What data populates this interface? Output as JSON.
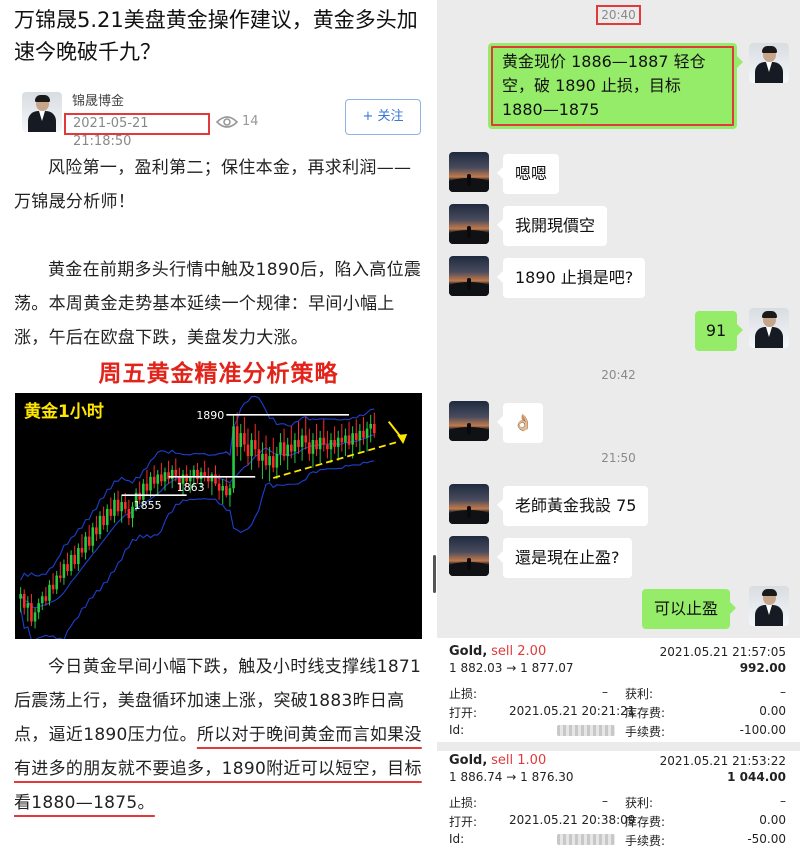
{
  "article": {
    "title": "万锦晟5.21美盘黄金操作建议，黄金多头加速今晚破千九？",
    "author": "锦晟博金",
    "time": "2021-05-21 21:18:50",
    "views": "14",
    "follow_label": "+ 关注",
    "para1": "风险第一，盈利第二；保住本金，再求利润——万锦晟分析师！",
    "para2": "黄金在前期多头行情中触及1890后，陷入高位震荡。本周黄金走势基本延续一个规律：早间小幅上涨，午后在欧盘下跌，美盘发力大涨。",
    "heading": "周五黄金精准分析策略",
    "para3_plain": "今日黄金早间小幅下跌，触及小时线支撑线1871后震荡上行，美盘循环加速上涨，突破1883昨日高点，逼近1890压力位。",
    "para3_underlined": "所以对于晚间黄金而言如果没有进多的朋友就不要追多，1890附近可以短空，目标看1880—1875。"
  },
  "chart_data": {
    "type": "candlestick",
    "title": "黄金1小时",
    "colors": {
      "up": "#27c93f",
      "down": "#ff2a2a",
      "band": "#1e3fd0",
      "level": "#ffffff",
      "trend": "#ffe600",
      "arrow": "#ffe600"
    },
    "levels": [
      {
        "label": "1890",
        "value": 1890
      },
      {
        "label": "1863",
        "value": 1863
      },
      {
        "label": "1855",
        "value": 1855
      }
    ],
    "x_range": [
      0,
      110
    ],
    "y_range": [
      1795,
      1896
    ],
    "trendline": {
      "from": [
        71,
        1862.5
      ],
      "to": [
        105,
        1878
      ]
    },
    "arrow": {
      "from": [
        103,
        1887
      ],
      "to": [
        107,
        1879
      ]
    },
    "candles": [
      [
        1810,
        1815,
        1804,
        1812
      ],
      [
        1812,
        1814,
        1803,
        1806
      ],
      [
        1806,
        1811,
        1800,
        1808
      ],
      [
        1808,
        1812,
        1798,
        1800
      ],
      [
        1800,
        1806,
        1797,
        1804
      ],
      [
        1804,
        1810,
        1801,
        1808
      ],
      [
        1808,
        1813,
        1805,
        1811
      ],
      [
        1811,
        1815,
        1807,
        1809
      ],
      [
        1809,
        1818,
        1807,
        1816
      ],
      [
        1816,
        1821,
        1812,
        1814
      ],
      [
        1814,
        1822,
        1812,
        1820
      ],
      [
        1820,
        1826,
        1817,
        1819
      ],
      [
        1819,
        1827,
        1816,
        1825
      ],
      [
        1825,
        1830,
        1820,
        1822
      ],
      [
        1822,
        1831,
        1820,
        1829
      ],
      [
        1829,
        1833,
        1823,
        1825
      ],
      [
        1825,
        1834,
        1822,
        1832
      ],
      [
        1832,
        1838,
        1828,
        1830
      ],
      [
        1830,
        1839,
        1827,
        1837
      ],
      [
        1837,
        1842,
        1831,
        1833
      ],
      [
        1833,
        1843,
        1830,
        1841
      ],
      [
        1841,
        1846,
        1835,
        1838
      ],
      [
        1838,
        1848,
        1836,
        1846
      ],
      [
        1846,
        1850,
        1840,
        1842
      ],
      [
        1842,
        1851,
        1839,
        1849
      ],
      [
        1849,
        1854,
        1844,
        1846
      ],
      [
        1846,
        1856,
        1843,
        1853
      ],
      [
        1853,
        1857,
        1846,
        1848
      ],
      [
        1848,
        1855,
        1843,
        1852
      ],
      [
        1852,
        1856,
        1847,
        1849
      ],
      [
        1849,
        1853,
        1842,
        1845
      ],
      [
        1845,
        1852,
        1841,
        1850
      ],
      [
        1850,
        1858,
        1848,
        1856
      ],
      [
        1856,
        1861,
        1851,
        1853
      ],
      [
        1853,
        1862,
        1850,
        1860
      ],
      [
        1860,
        1866,
        1855,
        1857
      ],
      [
        1857,
        1865,
        1854,
        1863
      ],
      [
        1863,
        1868,
        1858,
        1860
      ],
      [
        1860,
        1866,
        1855,
        1864
      ],
      [
        1864,
        1869,
        1859,
        1861
      ],
      [
        1861,
        1867,
        1857,
        1865
      ],
      [
        1865,
        1870,
        1860,
        1862
      ],
      [
        1862,
        1868,
        1858,
        1866
      ],
      [
        1866,
        1871,
        1861,
        1863
      ],
      [
        1863,
        1867,
        1857,
        1860
      ],
      [
        1860,
        1866,
        1855,
        1864
      ],
      [
        1864,
        1868,
        1859,
        1861
      ],
      [
        1861,
        1866,
        1856,
        1863
      ],
      [
        1863,
        1868,
        1859,
        1866
      ],
      [
        1866,
        1869,
        1860,
        1862
      ],
      [
        1862,
        1867,
        1858,
        1865
      ],
      [
        1865,
        1870,
        1861,
        1863
      ],
      [
        1863,
        1867,
        1858,
        1861
      ],
      [
        1861,
        1865,
        1855,
        1864
      ],
      [
        1864,
        1868,
        1859,
        1860
      ],
      [
        1860,
        1864,
        1853,
        1857
      ],
      [
        1857,
        1862,
        1851,
        1859
      ],
      [
        1859,
        1863,
        1854,
        1855
      ],
      [
        1855,
        1860,
        1850,
        1858
      ],
      [
        1858,
        1890,
        1856,
        1885
      ],
      [
        1885,
        1891,
        1872,
        1876
      ],
      [
        1876,
        1886,
        1870,
        1882
      ],
      [
        1882,
        1889,
        1874,
        1877
      ],
      [
        1877,
        1884,
        1868,
        1872
      ],
      [
        1872,
        1882,
        1866,
        1879
      ],
      [
        1879,
        1886,
        1872,
        1875
      ],
      [
        1875,
        1883,
        1867,
        1870
      ],
      [
        1870,
        1878,
        1862,
        1873
      ],
      [
        1873,
        1881,
        1866,
        1868
      ],
      [
        1868,
        1876,
        1861,
        1872
      ],
      [
        1872,
        1880,
        1865,
        1867
      ],
      [
        1867,
        1876,
        1862,
        1873
      ],
      [
        1873,
        1882,
        1868,
        1878
      ],
      [
        1878,
        1884,
        1870,
        1872
      ],
      [
        1872,
        1880,
        1866,
        1877
      ],
      [
        1877,
        1885,
        1871,
        1874
      ],
      [
        1874,
        1882,
        1869,
        1879
      ],
      [
        1879,
        1887,
        1873,
        1876
      ],
      [
        1876,
        1884,
        1870,
        1881
      ],
      [
        1881,
        1889,
        1875,
        1878
      ],
      [
        1878,
        1884,
        1870,
        1873
      ],
      [
        1873,
        1882,
        1867,
        1879
      ],
      [
        1879,
        1886,
        1872,
        1875
      ],
      [
        1875,
        1883,
        1869,
        1880
      ],
      [
        1880,
        1888,
        1874,
        1877
      ],
      [
        1877,
        1883,
        1871,
        1875
      ],
      [
        1875,
        1882,
        1869,
        1879
      ],
      [
        1879,
        1885,
        1873,
        1876
      ],
      [
        1876,
        1883,
        1870,
        1880
      ],
      [
        1880,
        1886,
        1874,
        1878
      ],
      [
        1878,
        1884,
        1872,
        1881
      ],
      [
        1881,
        1887,
        1875,
        1877
      ],
      [
        1877,
        1885,
        1871,
        1882
      ],
      [
        1882,
        1888,
        1876,
        1879
      ],
      [
        1879,
        1886,
        1873,
        1883
      ],
      [
        1883,
        1889,
        1877,
        1880
      ],
      [
        1880,
        1887,
        1874,
        1884
      ],
      [
        1884,
        1890,
        1878,
        1886
      ],
      [
        1886,
        1891,
        1880,
        1882
      ]
    ]
  },
  "chat": {
    "ts1": "20:40",
    "msg_out_1": "黄金现价 1886—1887 轻仓空，破 1890 止损，目标 1880—1875",
    "msg_in_1": "嗯嗯",
    "msg_in_2": "我開現價空",
    "msg_in_3": "1890 止損是吧?",
    "msg_out_2": "91",
    "ts2": "20:42",
    "msg_in_4": "👌🏼",
    "ts3": "21:50",
    "msg_in_5": "老師黃金我設 75",
    "msg_in_6": "還是現在止盈?",
    "msg_out_3": "可以止盈"
  },
  "trades": [
    {
      "symbol": "Gold,",
      "side": "sell 2.00",
      "close_time": "2021.05.21 21:57:05",
      "prices": "1 882.03 → 1 877.07",
      "profit": "992.00",
      "sl_label": "止损:",
      "sl_value": "–",
      "tp_label": "获利:",
      "tp_value": "–",
      "open_label": "打开:",
      "open_time": "2021.05.21 20:21:21",
      "swap_label": "库存费:",
      "swap_value": "0.00",
      "id_label": "Id:",
      "fee_label": "手续费:",
      "fee_value": "-100.00"
    },
    {
      "symbol": "Gold,",
      "side": "sell 1.00",
      "close_time": "2021.05.21 21:53:22",
      "prices": "1 886.74 → 1 876.30",
      "profit": "1 044.00",
      "sl_label": "止损:",
      "sl_value": "–",
      "tp_label": "获利:",
      "tp_value": "–",
      "open_label": "打开:",
      "open_time": "2021.05.21 20:38:09",
      "swap_label": "库存费:",
      "swap_value": "0.00",
      "id_label": "Id:",
      "fee_label": "手续费:",
      "fee_value": "-50.00"
    }
  ]
}
